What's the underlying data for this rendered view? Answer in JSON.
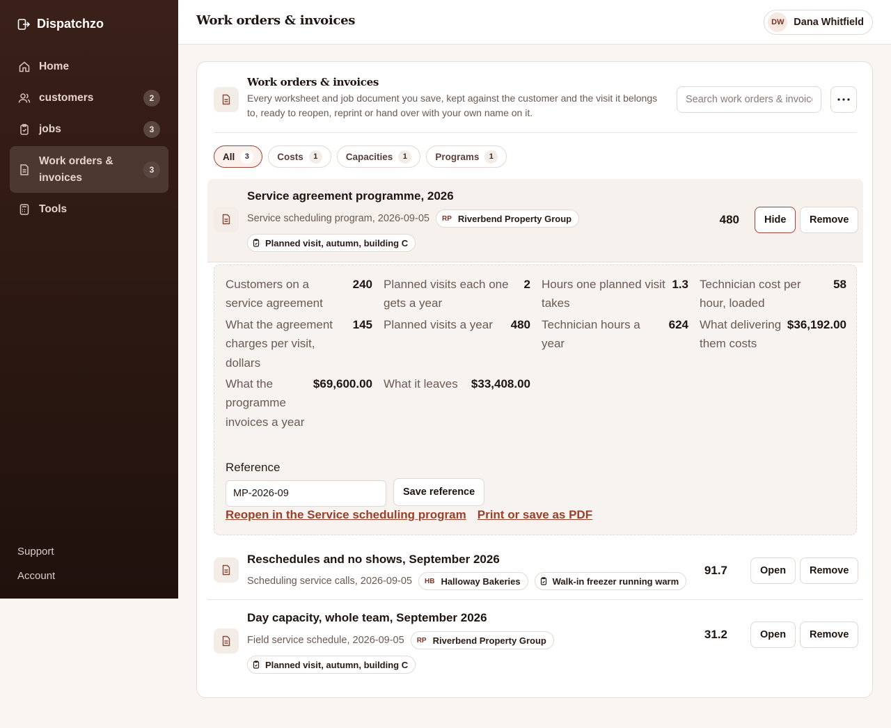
{
  "app": {
    "name": "Dispatchzo"
  },
  "sidebar": {
    "items": [
      {
        "label": "Home",
        "count": ""
      },
      {
        "label": "customers",
        "count": "2"
      },
      {
        "label": "jobs",
        "count": "3"
      },
      {
        "label": "Work orders & invoices",
        "count": "3"
      },
      {
        "label": "Tools",
        "count": ""
      }
    ],
    "footer": {
      "support": "Support",
      "account": "Account"
    }
  },
  "header": {
    "title": "Work orders & invoices",
    "user": {
      "initials": "DW",
      "name": "Dana Whitfield"
    }
  },
  "panel": {
    "title": "Work orders & invoices",
    "description": "Every worksheet and job document you save, kept against the customer and the visit it belongs to, ready to reopen, reprint or hand over with your own name on it.",
    "search_placeholder": "Search work orders & invoices"
  },
  "tabs": [
    {
      "label": "All",
      "count": "3"
    },
    {
      "label": "Costs",
      "count": "1"
    },
    {
      "label": "Capacities",
      "count": "1"
    },
    {
      "label": "Programs",
      "count": "1"
    }
  ],
  "records": [
    {
      "title": "Service agreement programme, 2026",
      "meta": "Service scheduling program, 2026-09-05",
      "customer_initials": "RP",
      "customer": "Riverbend Property Group",
      "job": "Planned visit, autumn, building C",
      "value": "480",
      "primary_action": "Hide",
      "remove": "Remove"
    },
    {
      "title": "Reschedules and no shows, September 2026",
      "meta": "Scheduling service calls, 2026-09-05",
      "customer_initials": "HB",
      "customer": "Halloway Bakeries",
      "job": "Walk-in freezer running warm",
      "value": "91.7",
      "primary_action": "Open",
      "remove": "Remove"
    },
    {
      "title": "Day capacity, whole team, September 2026",
      "meta": "Field service schedule, 2026-09-05",
      "customer_initials": "RP",
      "customer": "Riverbend Property Group",
      "job": "Planned visit, autumn, building C",
      "value": "31.2",
      "primary_action": "Open",
      "remove": "Remove"
    }
  ],
  "details": {
    "metrics": [
      {
        "label": "Customers on a service agreement",
        "value": "240"
      },
      {
        "label": "Planned visits each one gets a year",
        "value": "2"
      },
      {
        "label": "Hours one planned visit takes",
        "value": "1.3"
      },
      {
        "label": "Technician cost per hour, loaded",
        "value": "58"
      },
      {
        "label": "What the agreement charges per visit, dollars",
        "value": "145"
      },
      {
        "label": "Planned visits a year",
        "value": "480"
      },
      {
        "label": "Technician hours a year",
        "value": "624"
      },
      {
        "label": "What delivering them costs",
        "value": "$36,192.00"
      },
      {
        "label": "What the programme invoices a year",
        "value": "$69,600.00"
      },
      {
        "label": "What it leaves",
        "value": "$33,408.00"
      }
    ],
    "reference_label": "Reference",
    "reference_value": "MP-2026-09",
    "save_reference": "Save reference",
    "reopen_link": "Reopen in the Service scheduling program",
    "print_link": "Print or save as PDF"
  }
}
